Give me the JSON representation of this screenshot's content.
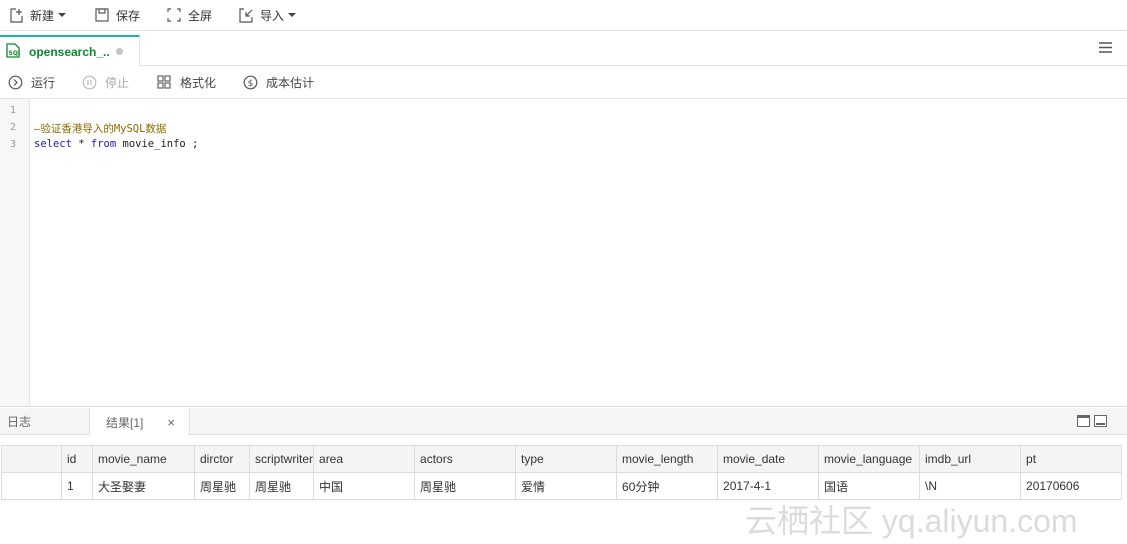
{
  "toolbar": {
    "new_label": "新建",
    "save_label": "保存",
    "fullscreen_label": "全屏",
    "import_label": "导入"
  },
  "tab": {
    "title": "opensearch_..",
    "icon": "sql-file-icon"
  },
  "editor_toolbar": {
    "run_label": "运行",
    "stop_label": "停止",
    "format_label": "格式化",
    "cost_label": "成本估计"
  },
  "editor": {
    "line_numbers": [
      "1",
      "2",
      "3"
    ],
    "line2_comment": "—验证香港导入的MySQL数据",
    "line3_select": "select",
    "line3_star": " * ",
    "line3_from": "from",
    "line3_rest": " movie_info ;"
  },
  "bottom_panel": {
    "log_tab": "日志",
    "result_tab": "结果[1]",
    "close_symbol": "×"
  },
  "result_table": {
    "columns": [
      "",
      "id",
      "movie_name",
      "dirctor",
      "scriptwriter",
      "area",
      "actors",
      "type",
      "movie_length",
      "movie_date",
      "movie_language",
      "imdb_url",
      "pt"
    ],
    "rows": [
      [
        "",
        "1",
        "大圣娶妻",
        "周星驰",
        "周星驰",
        "中国",
        "周星驰",
        "爱情",
        "60分钟",
        "2017-4-1",
        "国语",
        "\\N",
        "20170606"
      ]
    ]
  },
  "watermark": "云栖社区 yq.aliyun.com",
  "colors": {
    "tab_accent": "#1eb2a6",
    "tab_title": "#0b8a2f",
    "comment": "#8a6d00",
    "keyword": "#1b1bb0"
  }
}
